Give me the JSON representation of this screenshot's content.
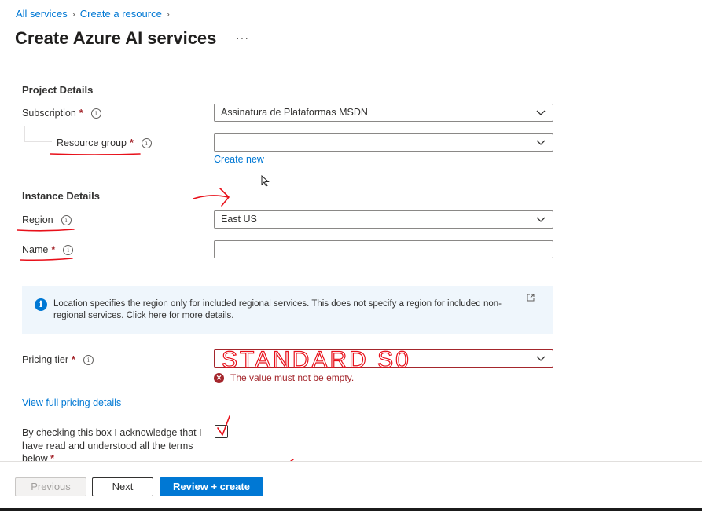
{
  "breadcrumb": {
    "items": [
      "All services",
      "Create a resource"
    ]
  },
  "page": {
    "title": "Create Azure AI services",
    "more": "···"
  },
  "project_details": {
    "heading": "Project Details",
    "subscription": {
      "label": "Subscription",
      "value": "Assinatura de Plataformas MSDN"
    },
    "resource_group": {
      "label": "Resource group",
      "value": "",
      "create_new": "Create new"
    }
  },
  "instance_details": {
    "heading": "Instance Details",
    "region": {
      "label": "Region",
      "value": "East US"
    },
    "name": {
      "label": "Name",
      "value": ""
    }
  },
  "info_box": {
    "text": "Location specifies the region only for included regional services. This does not specify a region for included non-regional services. Click here for more details."
  },
  "pricing": {
    "label": "Pricing tier",
    "value": "",
    "error": "The value must not be empty.",
    "view_details": "View full pricing details"
  },
  "acknowledge": {
    "text": "By checking this box I acknowledge that I have read and understood all the terms below"
  },
  "footer": {
    "previous": "Previous",
    "next": "Next",
    "review_create": "Review + create"
  },
  "annotations": {
    "handwritten_text": "STANDARD S0"
  },
  "colors": {
    "accent": "#0078d4",
    "error": "#a4262c",
    "annotation": "#e8101a"
  }
}
